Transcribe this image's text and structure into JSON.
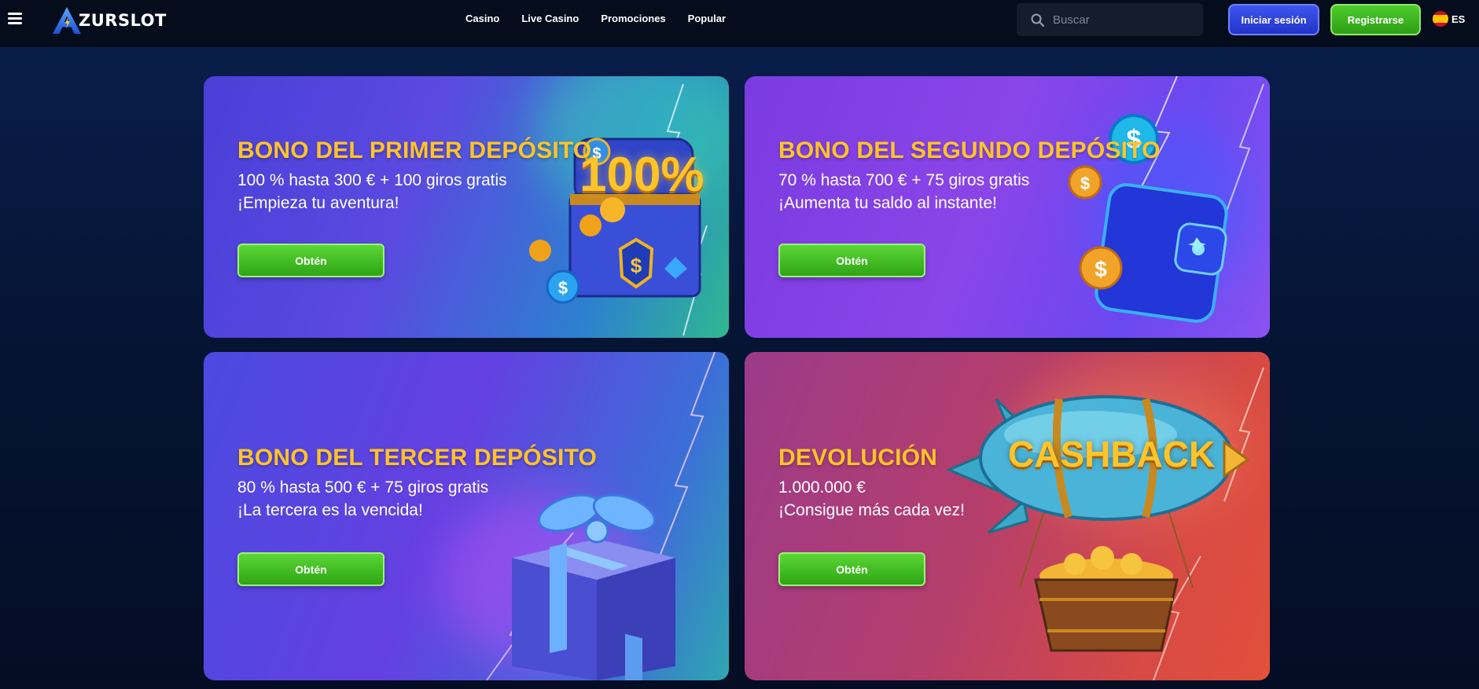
{
  "header": {
    "logo_text": "ZURSLOT",
    "nav": [
      "Casino",
      "Live Casino",
      "Promociones",
      "Popular"
    ],
    "search_placeholder": "Buscar",
    "login_label": "Iniciar sesión",
    "register_label": "Registrarse",
    "lang_code": "ES"
  },
  "promos": [
    {
      "title": "BONO DEL PRIMER DEPÓSITO",
      "line1": "100 % hasta 300 € + 100 giros gratis",
      "line2": "¡Empieza tu aventura!",
      "button": "Obtén",
      "art_text": "100%"
    },
    {
      "title": "BONO DEL SEGUNDO DEPÓSITO",
      "line1": "70 % hasta 700 € + 75 giros gratis",
      "line2": "¡Aumenta tu saldo al instante!",
      "button": "Obtén"
    },
    {
      "title": "BONO DEL TERCER DEPÓSITO",
      "line1": "80 % hasta 500 € + 75 giros gratis",
      "line2": "¡La tercera es la vencida!",
      "button": "Obtén"
    },
    {
      "title": "DEVOLUCIÓN",
      "line1": "1.000.000 €",
      "line2": "¡Consigue más cada vez!",
      "button": "Obtén",
      "art_text": "CASHBACK"
    }
  ],
  "colors": {
    "title": "#ffc429",
    "green_button": "#3fbf20",
    "login_blue": "#3347e6"
  },
  "icons": [
    "hamburger-icon",
    "logo-a-icon",
    "search-icon",
    "spain-flag-icon"
  ]
}
